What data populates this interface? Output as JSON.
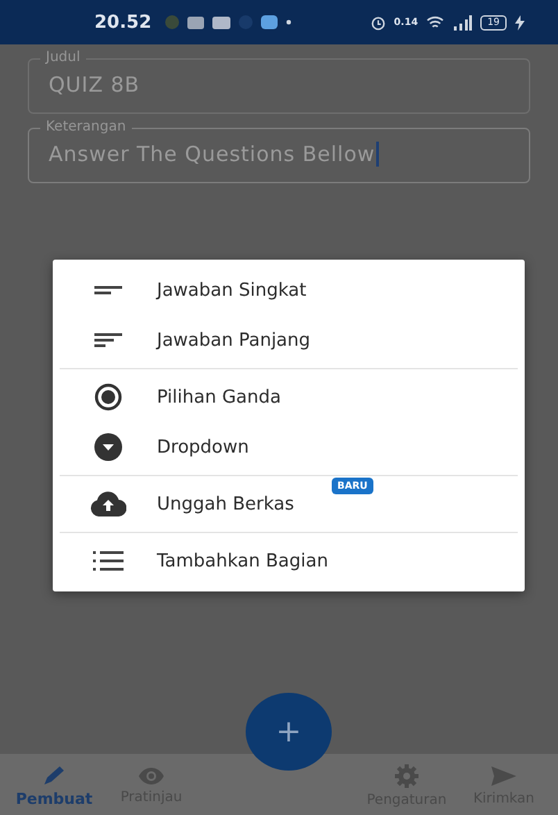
{
  "status_bar": {
    "time": "20.52",
    "net_speed": "0.14",
    "battery": "19"
  },
  "fields": [
    {
      "label": "Judul",
      "value": "QUIZ 8B",
      "focused": false
    },
    {
      "label": "Keterangan",
      "value": "Answer The Questions Bellow",
      "focused": true
    }
  ],
  "menu": {
    "sections": [
      {
        "items": [
          {
            "kind": "short",
            "label": "Jawaban Singkat"
          },
          {
            "kind": "long",
            "label": "Jawaban Panjang"
          }
        ]
      },
      {
        "items": [
          {
            "kind": "radio",
            "label": "Pilihan Ganda"
          },
          {
            "kind": "dropdown",
            "label": "Dropdown"
          }
        ]
      },
      {
        "items": [
          {
            "kind": "upload",
            "label": "Unggah Berkas",
            "badge": "BARU"
          }
        ]
      },
      {
        "items": [
          {
            "kind": "section",
            "label": "Tambahkan Bagian"
          }
        ]
      }
    ]
  },
  "fab": {
    "label": "+"
  },
  "bottom_nav": [
    {
      "kind": "edit",
      "label": "Pembuat",
      "selected": true
    },
    {
      "kind": "preview",
      "label": "Pratinjau",
      "selected": false
    },
    {
      "kind": "settings",
      "label": "Pengaturan",
      "selected": false
    },
    {
      "kind": "send",
      "label": "Kirimkan",
      "selected": false
    }
  ]
}
